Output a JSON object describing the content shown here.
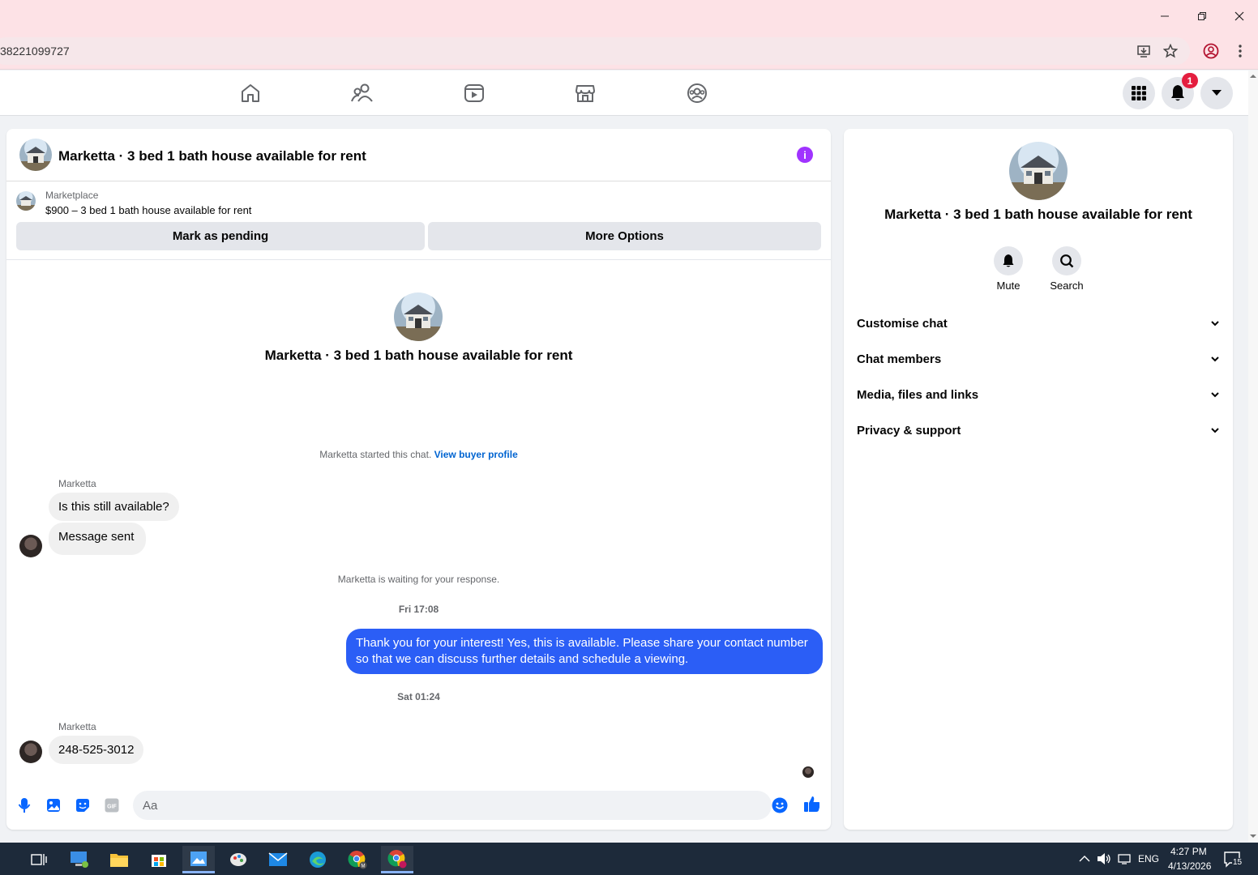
{
  "browser": {
    "url_fragment": "38221099727",
    "window_controls": [
      "minimize",
      "restore",
      "close"
    ]
  },
  "fb_nav": {
    "tabs": [
      "home-icon",
      "friends-icon",
      "video-icon",
      "marketplace-icon",
      "groups-icon"
    ],
    "notification_count": "1"
  },
  "chat": {
    "header_title": "Marketta · 3 bed 1 bath house available for rent",
    "marketplace_label": "Marketplace",
    "listing_title": "$900 – 3 bed 1 bath house available for rent",
    "mark_pending_label": "Mark as pending",
    "more_options_label": "More Options",
    "center_title": "Marketta · 3 bed 1 bath house available for rent",
    "started_note": "Marketta started this chat.",
    "view_buyer_profile": "View buyer profile",
    "messages": [
      {
        "sender": "Marketta",
        "text": "Is this still available?"
      },
      {
        "text": "Message sent"
      }
    ],
    "waiting_note": "Marketta is waiting for your response.",
    "time_1": "Fri 17:08",
    "outgoing_message": "Thank you for your interest! Yes, this is available. Please share your contact number so that we can discuss further details and schedule a viewing.",
    "time_2": "Sat 01:24",
    "reply_sender": "Marketta",
    "reply_text": "248-525-3012",
    "composer_placeholder": "Aa"
  },
  "info_panel": {
    "title": "Marketta · 3 bed 1 bath house available for rent",
    "mute_label": "Mute",
    "search_label": "Search",
    "sections": [
      "Customise chat",
      "Chat members",
      "Media, files and links",
      "Privacy & support"
    ]
  },
  "taskbar": {
    "language": "ENG",
    "time": "4:27 PM",
    "date": "4/13/2026",
    "notification_count": "15"
  },
  "colors": {
    "accent_blue": "#2b5ef6",
    "fb_blue": "#0866ff",
    "info_purple": "#a033ff",
    "chrome_pink": "#fde2e6"
  }
}
